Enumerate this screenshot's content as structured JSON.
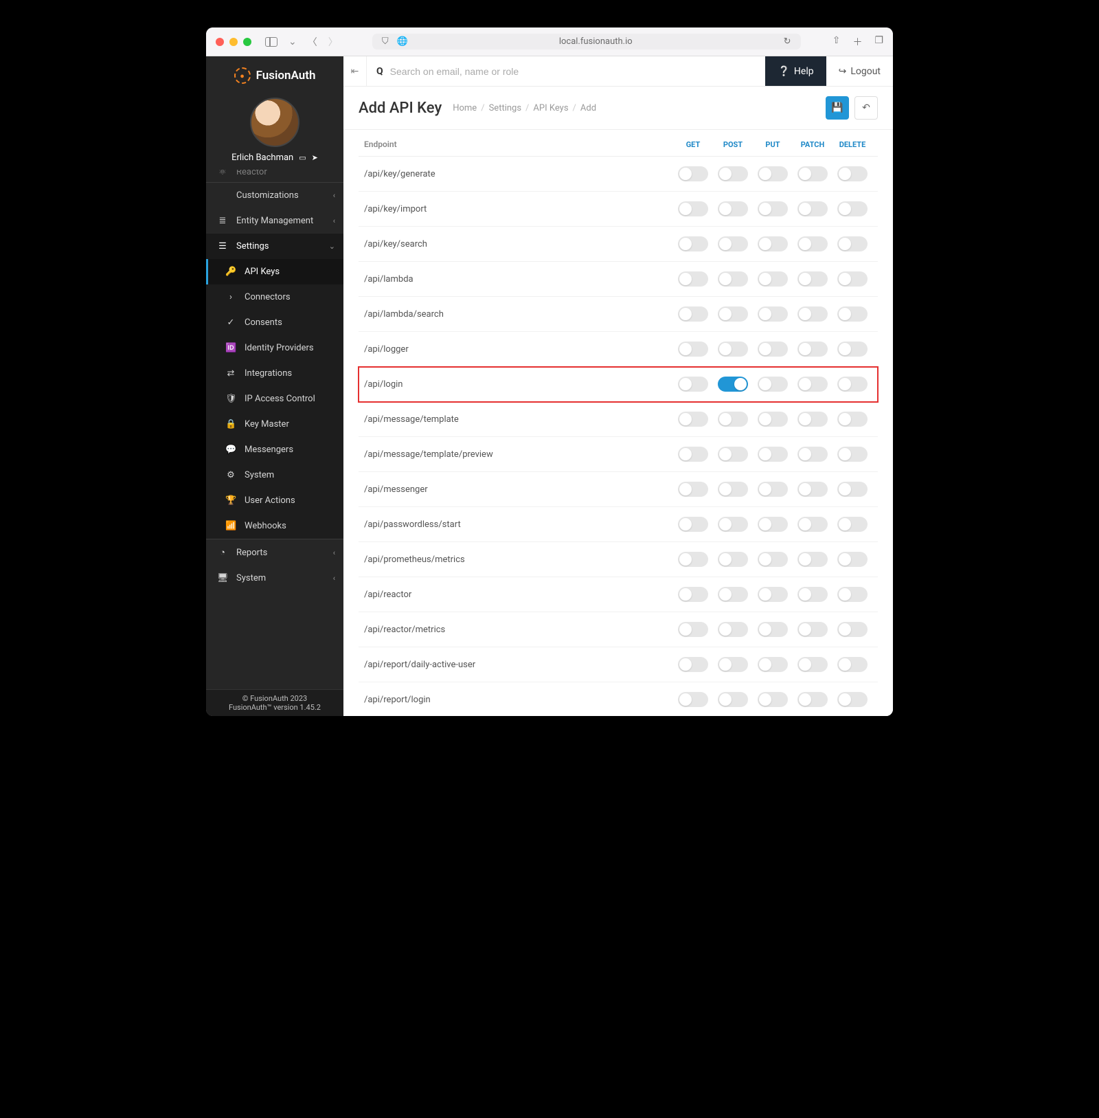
{
  "browser": {
    "url": "local.fusionauth.io"
  },
  "brand": "FusionAuth",
  "user": {
    "name": "Erlich Bachman"
  },
  "sidebar": {
    "top_cut": "Reactor",
    "items": [
      {
        "label": "Customizations",
        "icon": "</>"
      },
      {
        "label": "Entity Management",
        "icon": "≣"
      }
    ],
    "settings_label": "Settings",
    "settings_children": [
      {
        "label": "API Keys",
        "icon": "🔑",
        "active": true
      },
      {
        "label": "Connectors",
        "icon": "›"
      },
      {
        "label": "Consents",
        "icon": "✓"
      },
      {
        "label": "Identity Providers",
        "icon": "🆔"
      },
      {
        "label": "Integrations",
        "icon": "⇄"
      },
      {
        "label": "IP Access Control",
        "icon": "🛡"
      },
      {
        "label": "Key Master",
        "icon": "🔒"
      },
      {
        "label": "Messengers",
        "icon": "💬"
      },
      {
        "label": "System",
        "icon": "⚙"
      },
      {
        "label": "User Actions",
        "icon": "🏆"
      },
      {
        "label": "Webhooks",
        "icon": "📶"
      }
    ],
    "bottom": [
      {
        "label": "Reports",
        "icon": "◔"
      },
      {
        "label": "System",
        "icon": "🖥"
      }
    ],
    "footer1": "© FusionAuth 2023",
    "footer2": "FusionAuth™ version 1.45.2"
  },
  "topbar": {
    "search_placeholder": "Search on email, name or role",
    "help": "Help",
    "logout": "Logout"
  },
  "page": {
    "title": "Add API Key",
    "crumbs": [
      "Home",
      "Settings",
      "API Keys",
      "Add"
    ]
  },
  "table": {
    "header": "Endpoint",
    "methods": [
      "GET",
      "POST",
      "PUT",
      "PATCH",
      "DELETE"
    ],
    "rows": [
      {
        "endpoint": "/api/key/generate",
        "on": []
      },
      {
        "endpoint": "/api/key/import",
        "on": []
      },
      {
        "endpoint": "/api/key/search",
        "on": []
      },
      {
        "endpoint": "/api/lambda",
        "on": []
      },
      {
        "endpoint": "/api/lambda/search",
        "on": []
      },
      {
        "endpoint": "/api/logger",
        "on": []
      },
      {
        "endpoint": "/api/login",
        "on": [
          "POST"
        ],
        "highlight": true
      },
      {
        "endpoint": "/api/message/template",
        "on": []
      },
      {
        "endpoint": "/api/message/template/preview",
        "on": []
      },
      {
        "endpoint": "/api/messenger",
        "on": []
      },
      {
        "endpoint": "/api/passwordless/start",
        "on": []
      },
      {
        "endpoint": "/api/prometheus/metrics",
        "on": []
      },
      {
        "endpoint": "/api/reactor",
        "on": []
      },
      {
        "endpoint": "/api/reactor/metrics",
        "on": []
      },
      {
        "endpoint": "/api/report/daily-active-user",
        "on": []
      },
      {
        "endpoint": "/api/report/login",
        "on": []
      }
    ]
  }
}
